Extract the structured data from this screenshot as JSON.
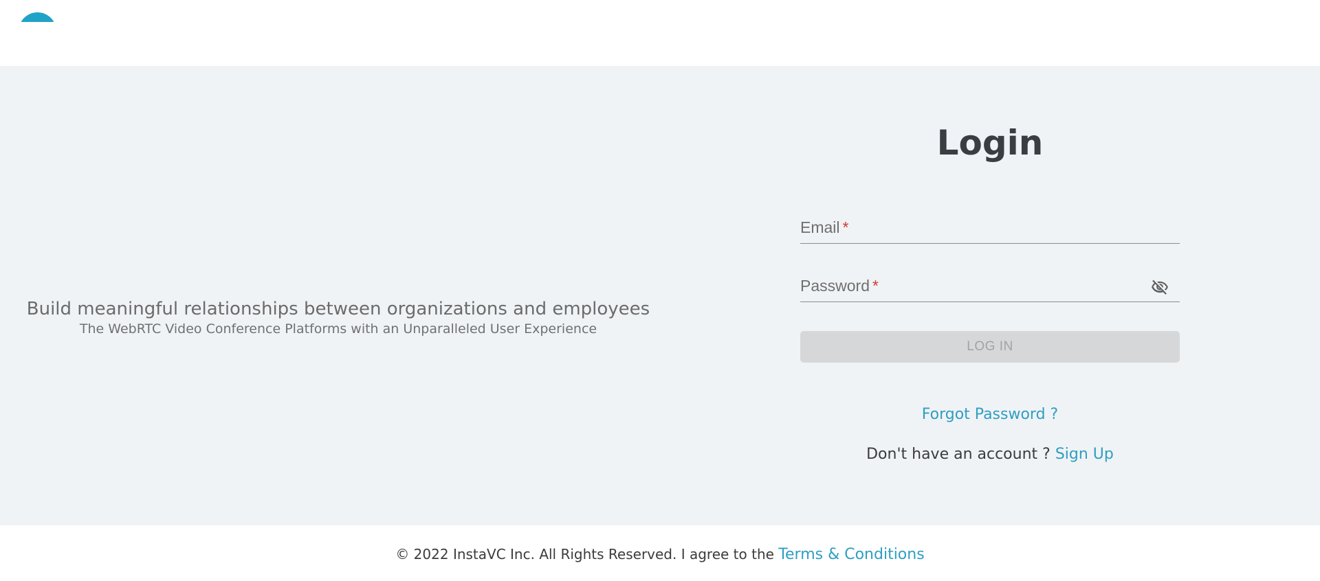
{
  "header": {
    "logo_icon": "instavc-logo-icon",
    "brand_color": "#20a3c6"
  },
  "hero": {
    "title": "Build meaningful relationships between organizations and employees",
    "subtitle": "The WebRTC Video Conference Platforms with an Unparalleled User Experience"
  },
  "login": {
    "title": "Login",
    "email_label": "Email",
    "email_value": "",
    "password_label": "Password",
    "password_value": "",
    "required_marker": "*",
    "visibility_icon": "eye-off-icon",
    "login_button": "LOG IN",
    "forgot_password": "Forgot Password ?",
    "no_account_text": "Don't have an account ?",
    "signup_link": "Sign Up"
  },
  "footer": {
    "copyright": "© 2022 InstaVC Inc. All Rights Reserved. I agree to the",
    "terms_link": "Terms & Conditions"
  },
  "colors": {
    "background": "#f0f3f6",
    "link": "#2f9ec1",
    "required": "#d23b30",
    "button_disabled": "#d6d7d9"
  }
}
